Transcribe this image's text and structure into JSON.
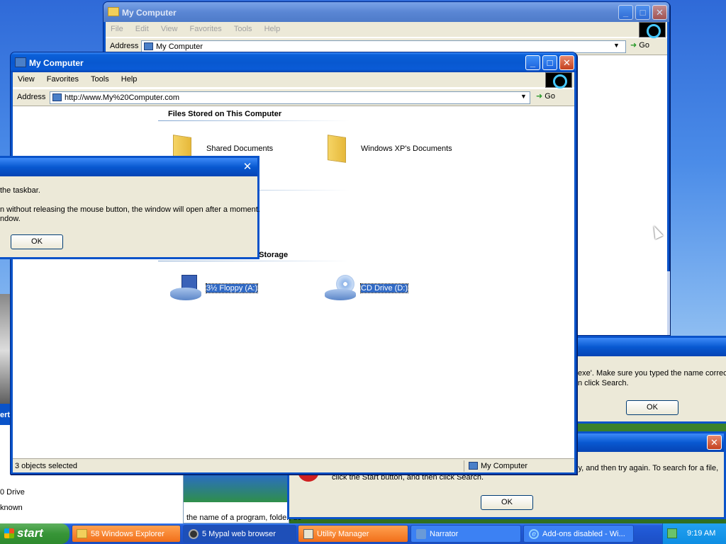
{
  "back_window": {
    "title": "My Computer",
    "menu": [
      "File",
      "Edit",
      "View",
      "Favorites",
      "Tools",
      "Help"
    ],
    "address_label": "Address",
    "address_value": "My Computer",
    "go_label": "Go"
  },
  "main_window": {
    "title": "My Computer",
    "menu": [
      "View",
      "Favorites",
      "Tools",
      "Help"
    ],
    "address_label": "Address",
    "address_value": "http://www.My%20Computer.com",
    "go_label": "Go",
    "section_files": "Files Stored on This Computer",
    "section_storage_partial": "e Storage",
    "items": {
      "shared_docs": "Shared Documents",
      "xp_docs": "Windows XP's Documents",
      "floppy": "3½ Floppy (A:)",
      "cd": "CD Drive (D:)"
    },
    "status_left": "3 objects selected",
    "status_right": "My Computer"
  },
  "dialog_left": {
    "line1": "the taskbar.",
    "line2": "n without releasing the mouse button, the window will open after a moment.",
    "line3": "ndow.",
    "ok": "OK"
  },
  "dialog_right_top": {
    "line1": "exe'. Make sure you typed the name correctly",
    "line2": "n click Search.",
    "ok": "OK"
  },
  "dialog_right_bottom": {
    "line1": "ly, and then try again. To search for a file,",
    "line2": "click the Start button, and then click Search.",
    "ok": "OK"
  },
  "left_panel": {
    "label_erti": "erti",
    "drive": "0 Drive",
    "unknown": "known"
  },
  "bottom_middle_text": "the name of a program, folder, do",
  "taskbar": {
    "start": "start",
    "items": [
      {
        "label": "58 Windows Explorer",
        "style": "orange"
      },
      {
        "label": "5 Mypal web browser",
        "style": "dark"
      },
      {
        "label": "Utility Manager",
        "style": "orange"
      },
      {
        "label": "Narrator",
        "style": "normal"
      },
      {
        "label": "Add-ons disabled - Wi...",
        "style": "normal"
      }
    ],
    "clock": "9:19 AM"
  },
  "colors": {
    "xp_blue": "#0a53c9",
    "taskbar_orange": "#f16f1a",
    "selection": "#316ac5"
  }
}
